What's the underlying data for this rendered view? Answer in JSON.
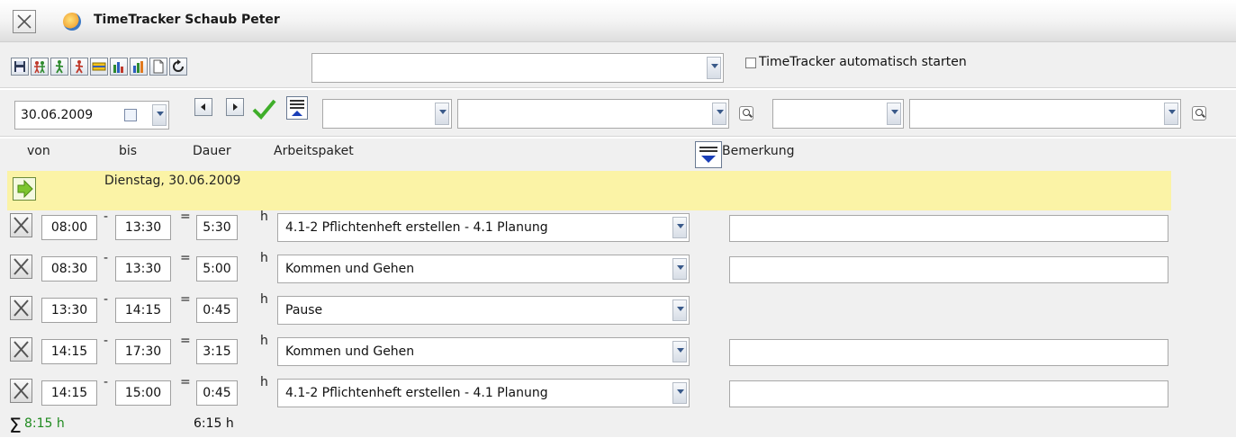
{
  "window": {
    "title": "TimeTracker Schaub Peter"
  },
  "toolbar": {
    "buttons": [
      "save-icon",
      "persons-icon",
      "walking-green-icon",
      "walking-red-icon",
      "ruler-icon",
      "bar-chart-icon",
      "bar-chart-2-icon",
      "new-document-icon",
      "refresh-icon"
    ],
    "combo_value": "",
    "autostart_label": "TimeTracker automatisch starten",
    "autostart_checked": false
  },
  "filter": {
    "date": "30.06.2009",
    "select1": "",
    "select2": "",
    "select3": "",
    "select4": ""
  },
  "columns": {
    "von": "von",
    "bis": "bis",
    "dauer": "Dauer",
    "arbeitspaket": "Arbeitspaket",
    "bemerkung": "Bemerkung"
  },
  "day": {
    "label": "Dienstag, 30.06.2009"
  },
  "entries": [
    {
      "von": "08:00",
      "bis": "13:30",
      "dauer": "5:30",
      "unit": "h",
      "paket": "4.1-2 Pflichtenheft erstellen - 4.1 Planung",
      "bemerkung": ""
    },
    {
      "von": "08:30",
      "bis": "13:30",
      "dauer": "5:00",
      "unit": "h",
      "paket": "Kommen und Gehen",
      "bemerkung": ""
    },
    {
      "von": "13:30",
      "bis": "14:15",
      "dauer": "0:45",
      "unit": "h",
      "paket": "Pause",
      "bemerkung": null
    },
    {
      "von": "14:15",
      "bis": "17:30",
      "dauer": "3:15",
      "unit": "h",
      "paket": "Kommen und Gehen",
      "bemerkung": ""
    },
    {
      "von": "14:15",
      "bis": "15:00",
      "dauer": "0:45",
      "unit": "h",
      "paket": "4.1-2 Pflichtenheft erstellen - 4.1 Planung",
      "bemerkung": ""
    }
  ],
  "ops": {
    "minus": "-",
    "equals": "="
  },
  "totals": {
    "sum_symbol": "Σ",
    "total": "8:15 h",
    "work": "6:15 h"
  },
  "colors": {
    "highlight": "#fbf3a6",
    "total_green": "#1f8a1f"
  }
}
